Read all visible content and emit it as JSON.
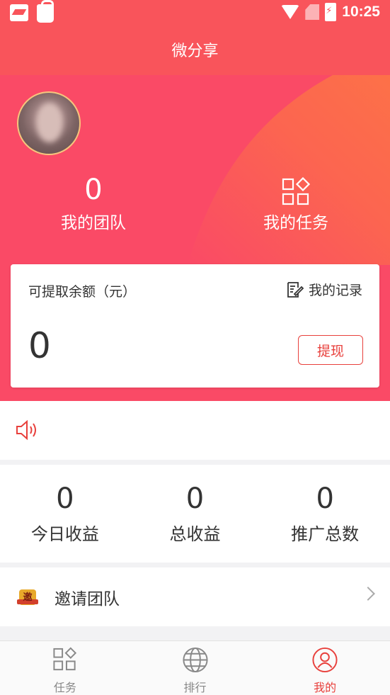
{
  "status_bar": {
    "time": "10:25"
  },
  "header": {
    "title": "微分享"
  },
  "profile": {
    "team": {
      "count": "0",
      "label": "我的团队"
    },
    "tasks": {
      "label": "我的任务"
    }
  },
  "balance_card": {
    "title": "可提取余额（元）",
    "records_label": "我的记录",
    "amount": "0",
    "withdraw_label": "提现"
  },
  "earnings": [
    {
      "value": "0",
      "label": "今日收益"
    },
    {
      "value": "0",
      "label": "总收益"
    },
    {
      "value": "0",
      "label": "推广总数"
    }
  ],
  "invite": {
    "badge": "邀",
    "label": "邀请团队"
  },
  "tabbar": {
    "items": [
      {
        "label": "任务",
        "icon": "grid-icon"
      },
      {
        "label": "排行",
        "icon": "globe-icon"
      },
      {
        "label": "我的",
        "icon": "user-icon"
      }
    ],
    "active": "我的"
  },
  "colors": {
    "primary": "#f9545b",
    "hero": "#fa4a66",
    "accent": "#e8403c"
  }
}
